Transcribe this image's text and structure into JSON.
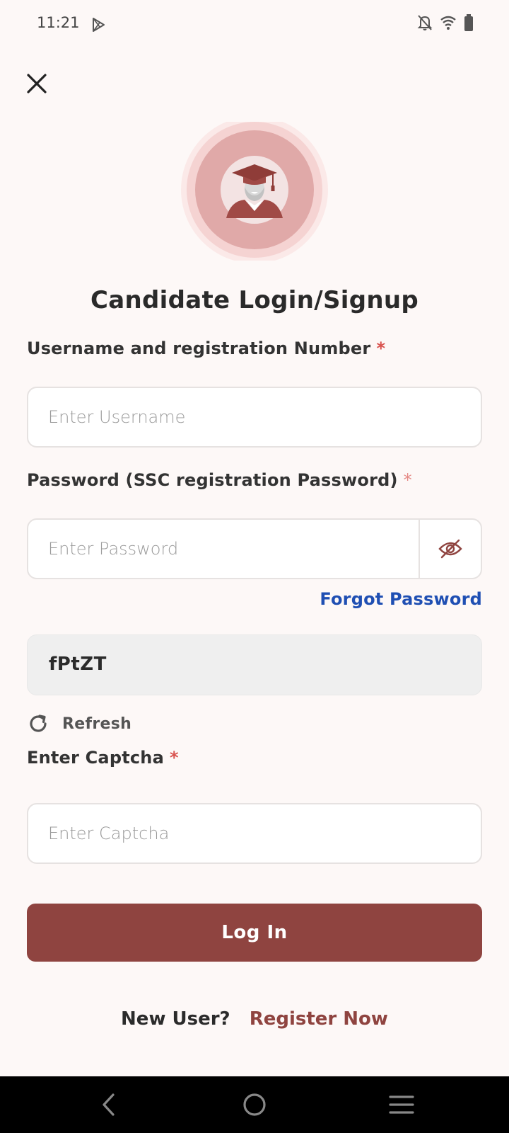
{
  "status_bar": {
    "time": "11:21"
  },
  "icons": {
    "play_store": "play-store-icon",
    "notifications_off": "notifications-off-icon",
    "wifi": "wifi-icon",
    "battery": "battery-icon",
    "close": "close-icon",
    "graduate": "graduate-avatar-icon",
    "eye_off": "eye-off-icon",
    "refresh": "refresh-icon",
    "nav_back": "back-icon",
    "nav_home": "home-icon",
    "nav_recents": "recents-menu-icon"
  },
  "colors": {
    "background": "#fdf8f7",
    "primary": "#8f4440",
    "link": "#1f4fb3",
    "required": "#d9534f",
    "captcha_bg": "#efefef"
  },
  "page": {
    "title": "Candidate Login/Signup"
  },
  "form": {
    "username": {
      "label": "Username and registration Number",
      "required_mark": "*",
      "placeholder": "Enter Username",
      "value": ""
    },
    "password": {
      "label": "Password (SSC registration Password)",
      "required_mark": "*",
      "placeholder": "Enter Password",
      "value": ""
    },
    "forgot_password": "Forgot Password",
    "captcha_code": "fPtZT",
    "refresh_label": "Refresh",
    "captcha": {
      "label": "Enter Captcha",
      "required_mark": "*",
      "placeholder": "Enter Captcha",
      "value": ""
    },
    "login_button": "Log In"
  },
  "register": {
    "prompt": "New User?",
    "link": "Register Now"
  }
}
